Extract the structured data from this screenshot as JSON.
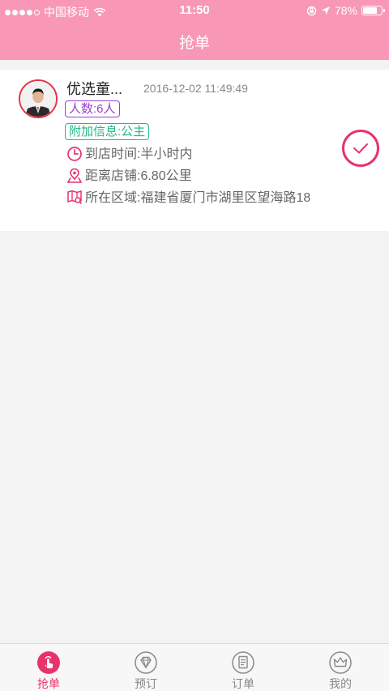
{
  "status_bar": {
    "carrier": "中国移动",
    "time": "11:50",
    "battery": "78%",
    "battery_level": 0.78
  },
  "header": {
    "title": "抢单"
  },
  "order": {
    "name": "优选童...",
    "datetime": "2016-12-02 11:49:49",
    "people": "人数:6人",
    "extra_info": "附加信息:公主",
    "arrival_time": "到店时间:半小时内",
    "distance": "距离店铺:6.80公里",
    "area": "所在区域:福建省厦门市湖里区望海路18"
  },
  "tabs": [
    {
      "label": "抢单",
      "icon": "hand-tap-icon",
      "active": true
    },
    {
      "label": "预订",
      "icon": "diamond-icon",
      "active": false
    },
    {
      "label": "订单",
      "icon": "document-icon",
      "active": false
    },
    {
      "label": "我的",
      "icon": "crown-icon",
      "active": false
    }
  ],
  "colors": {
    "header": "#f898b6",
    "accent": "#e8336a",
    "people_tag": "#9c3fd4",
    "extra_tag": "#1fb98a"
  }
}
